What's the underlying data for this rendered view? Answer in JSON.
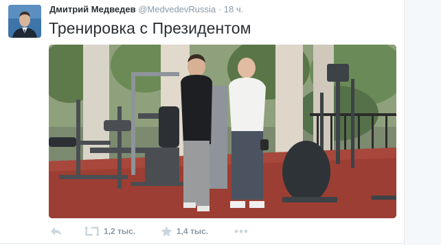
{
  "tweet": {
    "author": {
      "name": "Дмитрий Медведев",
      "handle": "@MedvedevRussia"
    },
    "separator": "·",
    "time": "18 ч.",
    "text": "Тренировка с Президентом"
  },
  "actions": {
    "reply": {
      "icon": "reply-icon"
    },
    "retweet": {
      "icon": "retweet-icon",
      "count": "1,2 тыс."
    },
    "favorite": {
      "icon": "star-icon",
      "count": "1,4 тыс."
    },
    "more": {
      "icon": "more-dots-icon"
    }
  },
  "colors": {
    "text": "#292f33",
    "muted": "#8899a6",
    "icon": "#ccd6dd",
    "divider": "#e1e8ed"
  }
}
